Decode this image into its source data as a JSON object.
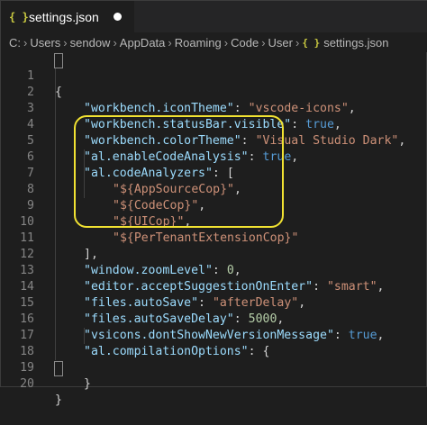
{
  "tab": {
    "icon": "{ }",
    "label": "settings.json"
  },
  "breadcrumb": {
    "items": [
      "C:",
      "Users",
      "sendow",
      "AppData",
      "Roaming",
      "Code",
      "User"
    ],
    "file_icon": "{ }",
    "file": "settings.json"
  },
  "lines": [
    {
      "n": "1"
    },
    {
      "n": "2"
    },
    {
      "n": "3"
    },
    {
      "n": "4"
    },
    {
      "n": "5"
    },
    {
      "n": "6"
    },
    {
      "n": "7"
    },
    {
      "n": "8"
    },
    {
      "n": "9"
    },
    {
      "n": "10"
    },
    {
      "n": "11"
    },
    {
      "n": "12"
    },
    {
      "n": "13"
    },
    {
      "n": "14"
    },
    {
      "n": "15"
    },
    {
      "n": "16"
    },
    {
      "n": "17"
    },
    {
      "n": "18"
    },
    {
      "n": "19"
    },
    {
      "n": "20"
    }
  ],
  "code": {
    "l1": "{",
    "l2k": "\"workbench.iconTheme\"",
    "l2v": "\"vscode-icons\"",
    "l3k": "\"workbench.statusBar.visible\"",
    "l3v": "true",
    "l4k": "\"workbench.colorTheme\"",
    "l4v": "\"Visual Studio Dark\"",
    "l5k": "\"al.enableCodeAnalysis\"",
    "l5v": "true",
    "l6k": "\"al.codeAnalyzers\"",
    "l6v": "[",
    "l7v": "\"${AppSourceCop}\"",
    "l8v": "\"${CodeCop}\"",
    "l9v": "\"${UICop}\"",
    "l10v": "\"${PerTenantExtensionCop}\"",
    "l11": "],",
    "l12k": "\"window.zoomLevel\"",
    "l12v": "0",
    "l13k": "\"editor.acceptSuggestionOnEnter\"",
    "l13v": "\"smart\"",
    "l14k": "\"files.autoSave\"",
    "l14v": "\"afterDelay\"",
    "l15k": "\"files.autoSaveDelay\"",
    "l15v": "5000",
    "l16k": "\"vsicons.dontShowNewVersionMessage\"",
    "l16v": "true",
    "l17k": "\"al.compilationOptions\"",
    "l17v": "{",
    "l19": "}",
    "l20": "}"
  },
  "colors": {
    "highlight": "#f1e232",
    "key": "#9cdcfe",
    "string": "#ce9178",
    "number": "#b5cea8",
    "boolean": "#569cd6"
  }
}
